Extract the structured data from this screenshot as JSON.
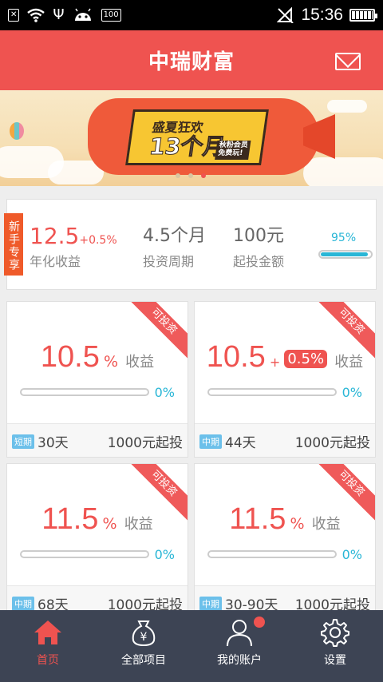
{
  "status_bar": {
    "time": "15:36",
    "battery_label": "100"
  },
  "header": {
    "title": "中瑞财富",
    "mail_icon": "mail-icon"
  },
  "banner": {
    "line1": "盛夏狂欢",
    "line2": "13个月",
    "line3a": "秋粉会员",
    "line3b": "免费玩!",
    "page_count": 3,
    "active_index": 2
  },
  "featured": {
    "tag": "新手专享",
    "rate": "12.5",
    "rate_plus": "+0.5%",
    "rate_label": "年化收益",
    "period": "4.5个月",
    "period_label": "投资周期",
    "min_amount": "100元",
    "min_amount_label": "起投金额",
    "progress": 0.95,
    "progress_label": "95%"
  },
  "products": [
    {
      "ribbon": "可投资",
      "rate": "10.5",
      "pct": "%",
      "bonus": "",
      "shouyi": "收益",
      "progress": 0,
      "progress_label": "0%",
      "term_tag": "短期",
      "term": "30天",
      "min": "1000元起投"
    },
    {
      "ribbon": "可投资",
      "rate": "10.5",
      "pct": "",
      "bonus_plus": "+",
      "bonus": "0.5%",
      "shouyi": "收益",
      "progress": 0,
      "progress_label": "0%",
      "term_tag": "中期",
      "term": "44天",
      "min": "1000元起投"
    },
    {
      "ribbon": "可投资",
      "rate": "11.5",
      "pct": "%",
      "bonus": "",
      "shouyi": "收益",
      "progress": 0,
      "progress_label": "0%",
      "term_tag": "中期",
      "term": "68天",
      "min": "1000元起投"
    },
    {
      "ribbon": "可投资",
      "rate": "11.5",
      "pct": "%",
      "bonus": "",
      "shouyi": "收益",
      "progress": 0,
      "progress_label": "0%",
      "term_tag": "中期",
      "term": "30-90天",
      "min": "1000元起投"
    }
  ],
  "nav": [
    {
      "label": "首页",
      "icon": "home-icon",
      "active": true
    },
    {
      "label": "全部项目",
      "icon": "money-bag-icon",
      "active": false
    },
    {
      "label": "我的账户",
      "icon": "user-icon",
      "active": false
    },
    {
      "label": "设置",
      "icon": "gear-icon",
      "active": false
    }
  ],
  "colors": {
    "brand": "#ef5350",
    "accent": "#29b6d6",
    "nav_bg": "#3d4454"
  }
}
